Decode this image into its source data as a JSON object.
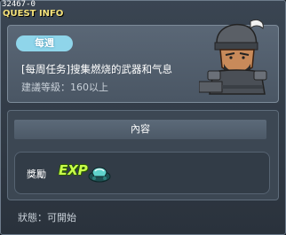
{
  "window": {
    "quest_id": "32467-0",
    "title": "QUEST INFO"
  },
  "quest": {
    "badge": "每週",
    "name": "[每周任务]搜集燃烧的武器和气息",
    "level_requirement": "建議等級：160以上"
  },
  "content": {
    "section_title": "內容",
    "reward_label": "獎勵",
    "reward_exp": "EXP",
    "reward_item_icon": "teal-gem-icon"
  },
  "status": {
    "text": "狀態：可開始"
  },
  "colors": {
    "title": "#f5e27a",
    "badge": "#8fd5ea",
    "exp": "#c8ff4a"
  }
}
